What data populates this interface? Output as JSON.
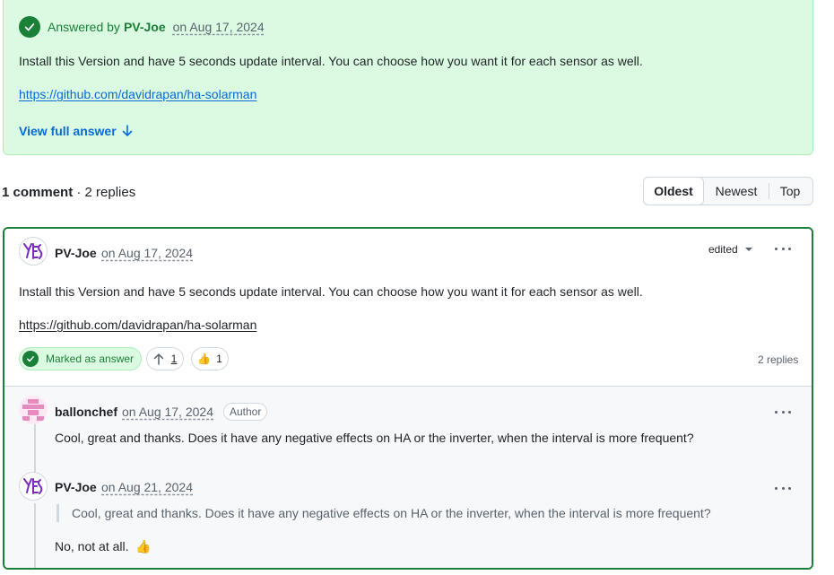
{
  "answer": {
    "label": "Answered by",
    "author": "PV-Joe",
    "date": "on Aug 17, 2024",
    "body": "Install this Version and have 5 seconds update interval. You can choose how you want it for each sensor as well.",
    "link": "https://github.com/davidrapan/ha-solarman",
    "view_full": "View full answer"
  },
  "comments_header": {
    "count_label": "1 comment",
    "replies_label": "· 2 replies",
    "sort_options": [
      "Oldest",
      "Newest",
      "Top"
    ],
    "selected_sort": "Oldest"
  },
  "main_comment": {
    "author": "PV-Joe",
    "date": "on Aug 17, 2024",
    "edited_label": "edited",
    "body": "Install this Version and have 5 seconds update interval. You can choose how you want it for each sensor as well.",
    "link": "https://github.com/davidrapan/ha-solarman",
    "marked_label": "Marked as answer",
    "upvotes": "1",
    "reaction_emoji": "👍",
    "reaction_count": "1",
    "replies_count": "2 replies"
  },
  "replies": [
    {
      "author": "ballonchef",
      "date": "on Aug 17, 2024",
      "badge": "Author",
      "body": "Cool, great and thanks. Does it have any negative effects on HA or the inverter, when the interval is more frequent?"
    },
    {
      "author": "PV-Joe",
      "date": "on Aug 21, 2024",
      "quote": "Cool, great and thanks. Does it have any negative effects on HA or the inverter, when the interval is more frequent?",
      "body": "No, not at all.",
      "emoji": "👍"
    }
  ],
  "colors": {
    "success": "#1a7f37",
    "answer_bg": "#dafbe1",
    "link": "#0969da",
    "muted": "#59636e"
  }
}
